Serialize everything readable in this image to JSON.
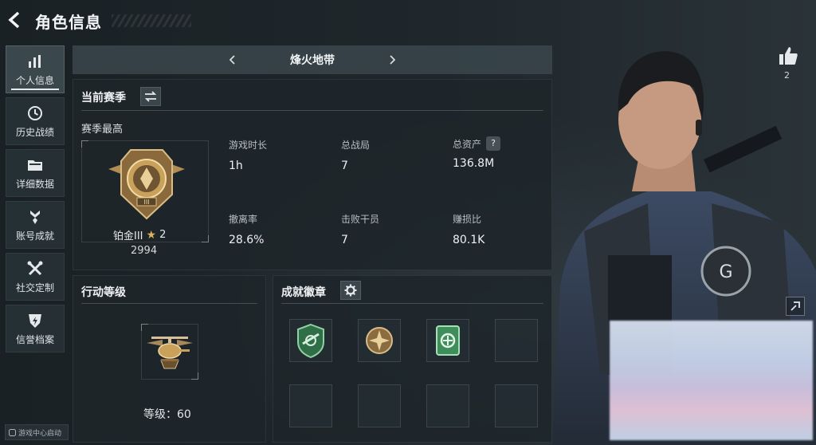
{
  "header": {
    "title": "角色信息"
  },
  "sidebar": {
    "items": [
      {
        "label": "个人信息",
        "icon": "bar-chart-icon",
        "active": true
      },
      {
        "label": "历史战绩",
        "icon": "clock-icon",
        "active": false
      },
      {
        "label": "详细数据",
        "icon": "folder-icon",
        "active": false
      },
      {
        "label": "账号成就",
        "icon": "achievement-icon",
        "active": false
      },
      {
        "label": "社交定制",
        "icon": "tools-icon",
        "active": false
      },
      {
        "label": "信誉档案",
        "icon": "shield-bolt-icon",
        "active": false
      }
    ],
    "launch_badge": "游戏中心启动"
  },
  "mode_bar": {
    "label": "烽火地带"
  },
  "season": {
    "title": "当前赛季",
    "best_label": "赛季最高",
    "rank_name": "铂金III",
    "rank_stars": "2",
    "rank_score": "2994",
    "stats": [
      {
        "label": "游戏时长",
        "value": "1h"
      },
      {
        "label": "总战局",
        "value": "7"
      },
      {
        "label": "总资产",
        "value": "136.8M",
        "help": "?"
      },
      {
        "label": "撤离率",
        "value": "28.6%"
      },
      {
        "label": "击败干员",
        "value": "7"
      },
      {
        "label": "赚损比",
        "value": "80.1K"
      }
    ]
  },
  "action_level": {
    "title": "行动等级",
    "level_text": "等级：60"
  },
  "achievements": {
    "title": "成就徽章"
  },
  "likes": {
    "count": "2"
  },
  "colors": {
    "background": "#1b2226",
    "panel": "#1e262a",
    "accent_gold": "#c9a15a",
    "badge_green": "#3f8d5a"
  }
}
